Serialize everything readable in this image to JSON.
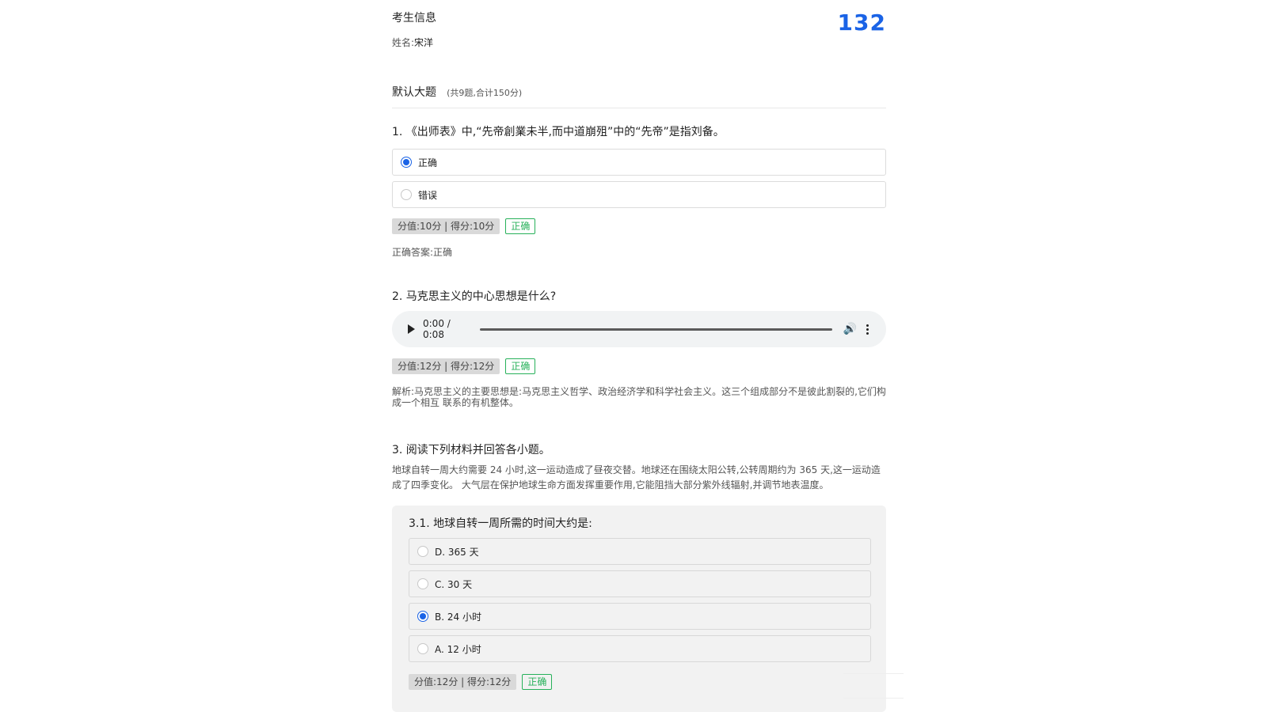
{
  "student": {
    "section_title": "考生信息",
    "name_label": "姓名:",
    "name_value": "宋洋",
    "total_score": "132"
  },
  "section": {
    "title": "默认大题",
    "summary": "(共9题,合计150分)"
  },
  "q1": {
    "title": "1. 《出师表》中,“先帝創業未半,而中道崩殂”中的“先帝”是指刘备。",
    "options": [
      {
        "label": "正确",
        "checked": true
      },
      {
        "label": "错误",
        "checked": false
      }
    ],
    "score_chip": "分值:10分 | 得分:10分",
    "status": "正确",
    "answer_label": "正确答案:",
    "answer_value": "正确"
  },
  "q2": {
    "title": "2. 马克思主义的中心思想是什么?",
    "audio_time": "0:00 / 0:08",
    "score_chip": "分值:12分 | 得分:12分",
    "status": "正确",
    "explanation": "解析:马克思主义的主要思想是:马克思主义哲学、政治经济学和科学社会主义。这三个组成部分不是彼此割裂的,它们构成一个相互 联系的有机整体。"
  },
  "q3": {
    "title": "3. 阅读下列材料并回答各小题。",
    "material": "地球自转一周大约需要 24 小时,这一运动造成了昼夜交替。地球还在围绕太阳公转,公转周期约为 365 天,这一运动造成了四季变化。 大气层在保护地球生命方面发挥重要作用,它能阻挡大部分紫外线辐射,并调节地表温度。",
    "sub1": {
      "title": "3.1. 地球自转一周所需的时间大约是:",
      "options": [
        {
          "label": "D. 365 天",
          "checked": false
        },
        {
          "label": "C. 30 天",
          "checked": false
        },
        {
          "label": "B. 24 小时",
          "checked": true
        },
        {
          "label": "A. 12 小时",
          "checked": false
        }
      ],
      "score_chip": "分值:12分 | 得分:12分",
      "status": "正确"
    }
  },
  "icons": {
    "play": "play-icon",
    "volume": "volume-icon",
    "more": "more-vertical-icon"
  },
  "colors": {
    "accent": "#1a63e6",
    "correct": "#27b15a"
  }
}
